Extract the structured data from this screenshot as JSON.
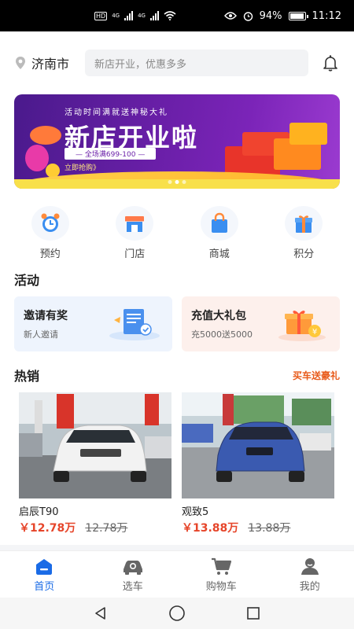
{
  "status": {
    "net1": "4G",
    "net2": "4G",
    "hd": "HD",
    "battery": "94%",
    "time": "11:12"
  },
  "header": {
    "city": "济南市",
    "search_placeholder": "新店开业，优惠多多"
  },
  "banner": {
    "small": "活动时间满就送神秘大礼",
    "title": "新店开业啦",
    "promo": "— 全场满699-100 —",
    "cta": "立即抢购》",
    "slides": 3
  },
  "quick": [
    {
      "label": "预约",
      "icon": "alarm-clock-icon"
    },
    {
      "label": "门店",
      "icon": "store-icon"
    },
    {
      "label": "商城",
      "icon": "shopping-bag-icon"
    },
    {
      "label": "积分",
      "icon": "gift-icon"
    }
  ],
  "activities": {
    "title": "活动",
    "items": [
      {
        "title": "邀请有奖",
        "subtitle": "新人邀请"
      },
      {
        "title": "充值大礼包",
        "subtitle": "充5000送5000"
      }
    ]
  },
  "hot": {
    "title": "热销",
    "tag": "买车送豪礼",
    "items": [
      {
        "name": "启辰T90",
        "price": "￥12.78万",
        "original": "12.78万"
      },
      {
        "name": "观致5",
        "price": "￥13.88万",
        "original": "13.88万"
      }
    ]
  },
  "tabs": [
    {
      "label": "首页",
      "icon": "home-icon",
      "active": true
    },
    {
      "label": "选车",
      "icon": "car-search-icon",
      "active": false
    },
    {
      "label": "购物车",
      "icon": "cart-icon",
      "active": false
    },
    {
      "label": "我的",
      "icon": "user-icon",
      "active": false
    }
  ],
  "colors": {
    "primary": "#1a6be6",
    "price": "#e6452a",
    "banner": "#6a1fa8"
  }
}
